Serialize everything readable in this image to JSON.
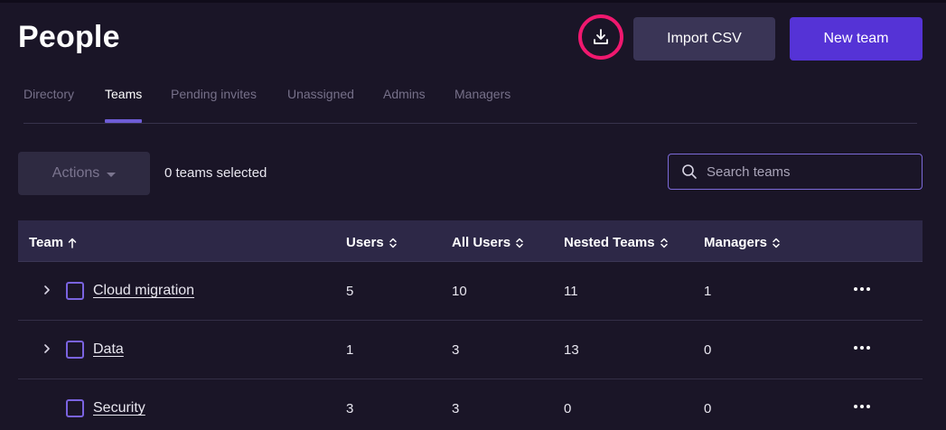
{
  "page": {
    "title": "People"
  },
  "header": {
    "download_icon": "download-icon",
    "import_label": "Import CSV",
    "new_team_label": "New team"
  },
  "tabs": [
    {
      "label": "Directory",
      "active": false
    },
    {
      "label": "Teams",
      "active": true
    },
    {
      "label": "Pending invites",
      "active": false
    },
    {
      "label": "Unassigned",
      "active": false
    },
    {
      "label": "Admins",
      "active": false
    },
    {
      "label": "Managers",
      "active": false
    }
  ],
  "toolbar": {
    "actions_label": "Actions",
    "selected_text": "0 teams selected",
    "search_placeholder": "Search teams"
  },
  "table": {
    "columns": [
      {
        "label": "Team",
        "sort": "asc"
      },
      {
        "label": "Users",
        "sort": "none"
      },
      {
        "label": "All Users",
        "sort": "none"
      },
      {
        "label": "Nested Teams",
        "sort": "none"
      },
      {
        "label": "Managers",
        "sort": "none"
      }
    ],
    "rows": [
      {
        "team": "Cloud migration",
        "users": "5",
        "all_users": "10",
        "nested_teams": "11",
        "managers": "1",
        "expandable": true
      },
      {
        "team": "Data",
        "users": "1",
        "all_users": "3",
        "nested_teams": "13",
        "managers": "0",
        "expandable": true
      },
      {
        "team": "Security",
        "users": "3",
        "all_users": "3",
        "nested_teams": "0",
        "managers": "0",
        "expandable": false
      }
    ]
  },
  "colors": {
    "background": "#1a1527",
    "accent": "#5533d6",
    "highlight_ring": "#f0186f",
    "table_header": "#2d2847"
  }
}
